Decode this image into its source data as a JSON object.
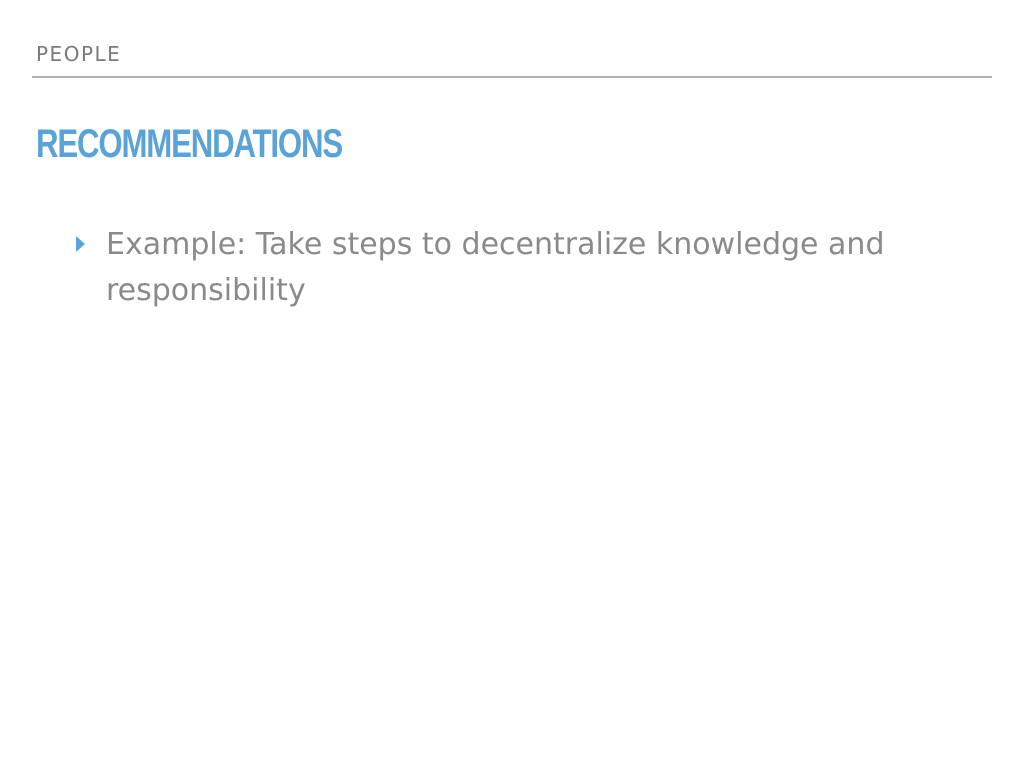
{
  "slide": {
    "section_label": "PEOPLE",
    "title": "RECOMMENDATIONS",
    "bullets": [
      {
        "text": "Example: Take steps to decentralize knowledge and responsibility"
      }
    ]
  },
  "colors": {
    "accent": "#5ba3d6",
    "body_text": "#8a8a8a",
    "label_text": "#7a7a7a",
    "rule": "#b3b3b3",
    "background": "#ffffff"
  },
  "icons": {
    "bullet": "triangle-right-icon"
  }
}
